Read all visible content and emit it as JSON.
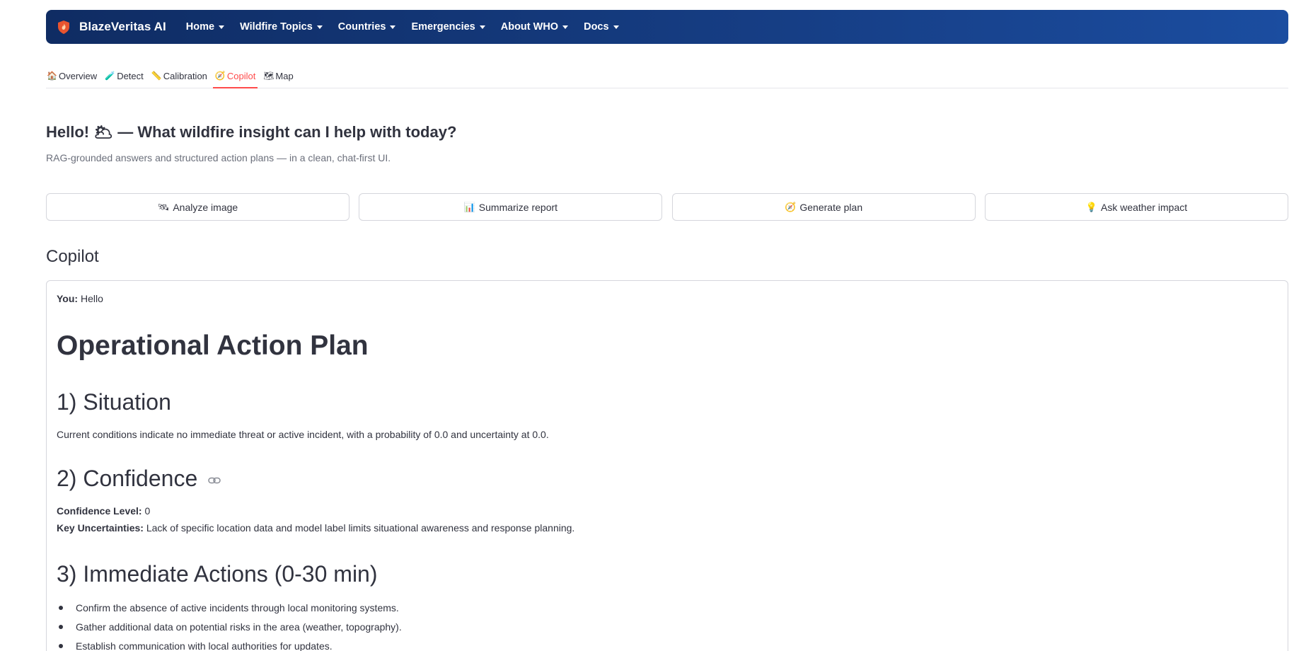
{
  "brand": {
    "name": "BlazeVeritas AI",
    "logo_icon": "shield-flame-icon",
    "colors": {
      "shield": "#e8542f",
      "flame": "#ffd2a8"
    }
  },
  "nav": {
    "items": [
      {
        "label": "Home"
      },
      {
        "label": "Wildfire Topics"
      },
      {
        "label": "Countries"
      },
      {
        "label": "Emergencies"
      },
      {
        "label": "About WHO"
      },
      {
        "label": "Docs"
      }
    ],
    "colors": {
      "gradient_start": "#0f2c63",
      "gradient_end": "#1b4da0"
    }
  },
  "tabs": {
    "active": "Copilot",
    "accent_color": "#ff4b4b",
    "items": [
      {
        "icon": "🏠",
        "label": "Overview"
      },
      {
        "icon": "🧪",
        "label": "Detect"
      },
      {
        "icon": "📏",
        "label": "Calibration"
      },
      {
        "icon": "🧭",
        "label": "Copilot"
      },
      {
        "icon": "🗺",
        "label": "Map"
      }
    ]
  },
  "hero": {
    "greeting": "Hello! 🌥 — What wildfire insight can I help with today?",
    "subtitle": "RAG-grounded answers and structured action plans — in a clean, chat-first UI."
  },
  "quick_actions": [
    {
      "icon": "🛰",
      "label": "Analyze image"
    },
    {
      "icon": "📊",
      "label": "Summarize report"
    },
    {
      "icon": "🧭",
      "label": "Generate plan"
    },
    {
      "icon": "💡",
      "label": "Ask weather impact"
    }
  ],
  "copilot": {
    "section_title": "Copilot",
    "user_prefix": "You:",
    "user_message": "Hello",
    "plan": {
      "title": "Operational Action Plan",
      "situation_heading": "1) Situation",
      "situation_text": "Current conditions indicate no immediate threat or active incident, with a probability of 0.0 and uncertainty at 0.0.",
      "confidence_heading": "2) Confidence",
      "confidence_level_label": "Confidence Level:",
      "confidence_level_value": "0",
      "uncertainties_label": "Key Uncertainties:",
      "uncertainties_value": "Lack of specific location data and model label limits situational awareness and response planning.",
      "actions_heading": "3) Immediate Actions (0-30 min)",
      "actions": [
        "Confirm the absence of active incidents through local monitoring systems.",
        "Gather additional data on potential risks in the area (weather, topography).",
        "Establish communication with local authorities for updates."
      ]
    }
  }
}
